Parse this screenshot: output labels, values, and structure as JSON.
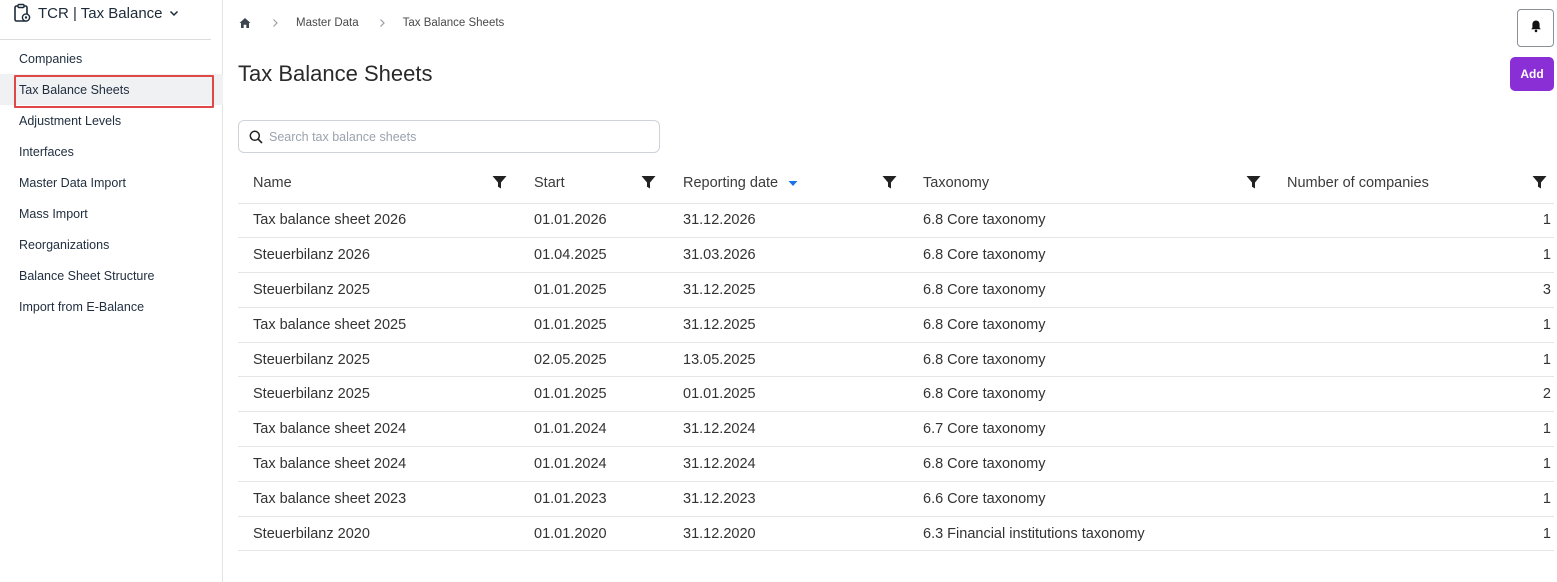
{
  "app": {
    "title": "TCR | Tax Balance"
  },
  "sidebar": {
    "items": [
      {
        "label": "Companies"
      },
      {
        "label": "Tax Balance Sheets"
      },
      {
        "label": "Adjustment Levels"
      },
      {
        "label": "Interfaces"
      },
      {
        "label": "Master Data Import"
      },
      {
        "label": "Mass Import"
      },
      {
        "label": "Reorganizations"
      },
      {
        "label": "Balance Sheet Structure"
      },
      {
        "label": "Import from E-Balance"
      }
    ],
    "active_index": 1
  },
  "breadcrumb": {
    "items": [
      "Master Data",
      "Tax Balance Sheets"
    ]
  },
  "header": {
    "title": "Tax Balance Sheets",
    "add_label": "Add"
  },
  "search": {
    "placeholder": "Search tax balance sheets",
    "value": ""
  },
  "table": {
    "columns": [
      "Name",
      "Start",
      "Reporting date",
      "Taxonomy",
      "Number of companies"
    ],
    "sorted_column": "Reporting date",
    "sort_direction": "descending",
    "rows": [
      {
        "name": "Tax balance sheet 2026",
        "start": "01.01.2026",
        "reporting_date": "31.12.2026",
        "taxonomy": "6.8 Core taxonomy",
        "companies": "1"
      },
      {
        "name": "Steuerbilanz 2026",
        "start": "01.04.2025",
        "reporting_date": "31.03.2026",
        "taxonomy": "6.8 Core taxonomy",
        "companies": "1"
      },
      {
        "name": "Steuerbilanz 2025",
        "start": "01.01.2025",
        "reporting_date": "31.12.2025",
        "taxonomy": "6.8 Core taxonomy",
        "companies": "3"
      },
      {
        "name": "Tax balance sheet 2025",
        "start": "01.01.2025",
        "reporting_date": "31.12.2025",
        "taxonomy": "6.8 Core taxonomy",
        "companies": "1"
      },
      {
        "name": "Steuerbilanz 2025",
        "start": "02.05.2025",
        "reporting_date": "13.05.2025",
        "taxonomy": "6.8 Core taxonomy",
        "companies": "1"
      },
      {
        "name": "Steuerbilanz 2025",
        "start": "01.01.2025",
        "reporting_date": "01.01.2025",
        "taxonomy": "6.8 Core taxonomy",
        "companies": "2"
      },
      {
        "name": "Tax balance sheet 2024",
        "start": "01.01.2024",
        "reporting_date": "31.12.2024",
        "taxonomy": "6.7 Core taxonomy",
        "companies": "1"
      },
      {
        "name": "Tax balance sheet 2024",
        "start": "01.01.2024",
        "reporting_date": "31.12.2024",
        "taxonomy": "6.8 Core taxonomy",
        "companies": "1"
      },
      {
        "name": "Tax balance sheet 2023",
        "start": "01.01.2023",
        "reporting_date": "31.12.2023",
        "taxonomy": "6.6 Core taxonomy",
        "companies": "1"
      },
      {
        "name": "Steuerbilanz 2020",
        "start": "01.01.2020",
        "reporting_date": "31.12.2020",
        "taxonomy": "6.3 Financial institutions taxonomy",
        "companies": "1"
      }
    ]
  },
  "colors": {
    "accent": "#8a2fd6",
    "sort_indicator": "#1a73e8",
    "highlight_border": "#e04848"
  },
  "icons": {
    "app": "clipboard-gear-icon",
    "home": "home-icon",
    "separator": "chevron-right-icon",
    "bell": "bell-icon",
    "search": "search-icon",
    "filter": "filter-icon",
    "sort": "sort-desc-icon"
  }
}
